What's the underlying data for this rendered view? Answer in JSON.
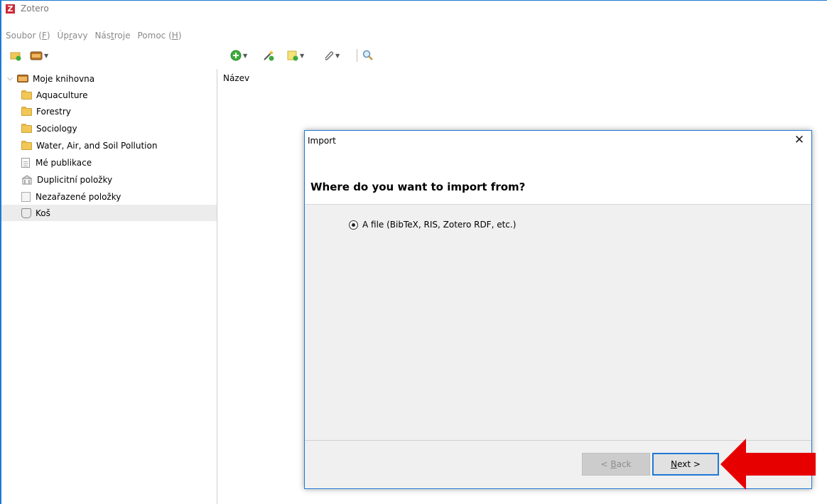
{
  "window": {
    "title": "Zotero"
  },
  "menu": {
    "items": [
      {
        "label": "Soubor (F)",
        "pre": "Soubor (",
        "key": "F",
        "post": ")"
      },
      {
        "label": "Úpravy",
        "pre": "Úp",
        "key": "r",
        "post": "avy"
      },
      {
        "label": "Nástroje",
        "pre": "Nás",
        "key": "t",
        "post": "roje"
      },
      {
        "label": "Pomoc (H)",
        "pre": "Pomoc (",
        "key": "H",
        "post": ")"
      }
    ]
  },
  "sidebar": {
    "items": [
      {
        "label": "Moje knihovna",
        "icon": "library-icon"
      },
      {
        "label": "Aquaculture",
        "icon": "folder-icon"
      },
      {
        "label": "Forestry",
        "icon": "folder-icon"
      },
      {
        "label": "Sociology",
        "icon": "folder-icon"
      },
      {
        "label": "Water, Air, and Soil Pollution",
        "icon": "folder-icon"
      },
      {
        "label": "Mé publikace",
        "icon": "document-icon"
      },
      {
        "label": "Duplicitní položky",
        "icon": "duplicates-icon"
      },
      {
        "label": "Nezařazené položky",
        "icon": "unfiled-icon"
      },
      {
        "label": "Koš",
        "icon": "trash-icon"
      }
    ]
  },
  "items_pane": {
    "column_title": "Název"
  },
  "dialog": {
    "title": "Import",
    "close_glyph": "✕",
    "heading": "Where do you want to import from?",
    "option_label": "A file (BibTeX, RIS, Zotero RDF, etc.)",
    "back_button": {
      "pre": "< ",
      "key": "B",
      "post": "ack"
    },
    "next_button": {
      "pre": "",
      "key": "N",
      "post": "ext >"
    }
  },
  "colors": {
    "accent": "#1e78d4",
    "zotero_red": "#cc2936",
    "annotation_arrow": "#e60000"
  }
}
